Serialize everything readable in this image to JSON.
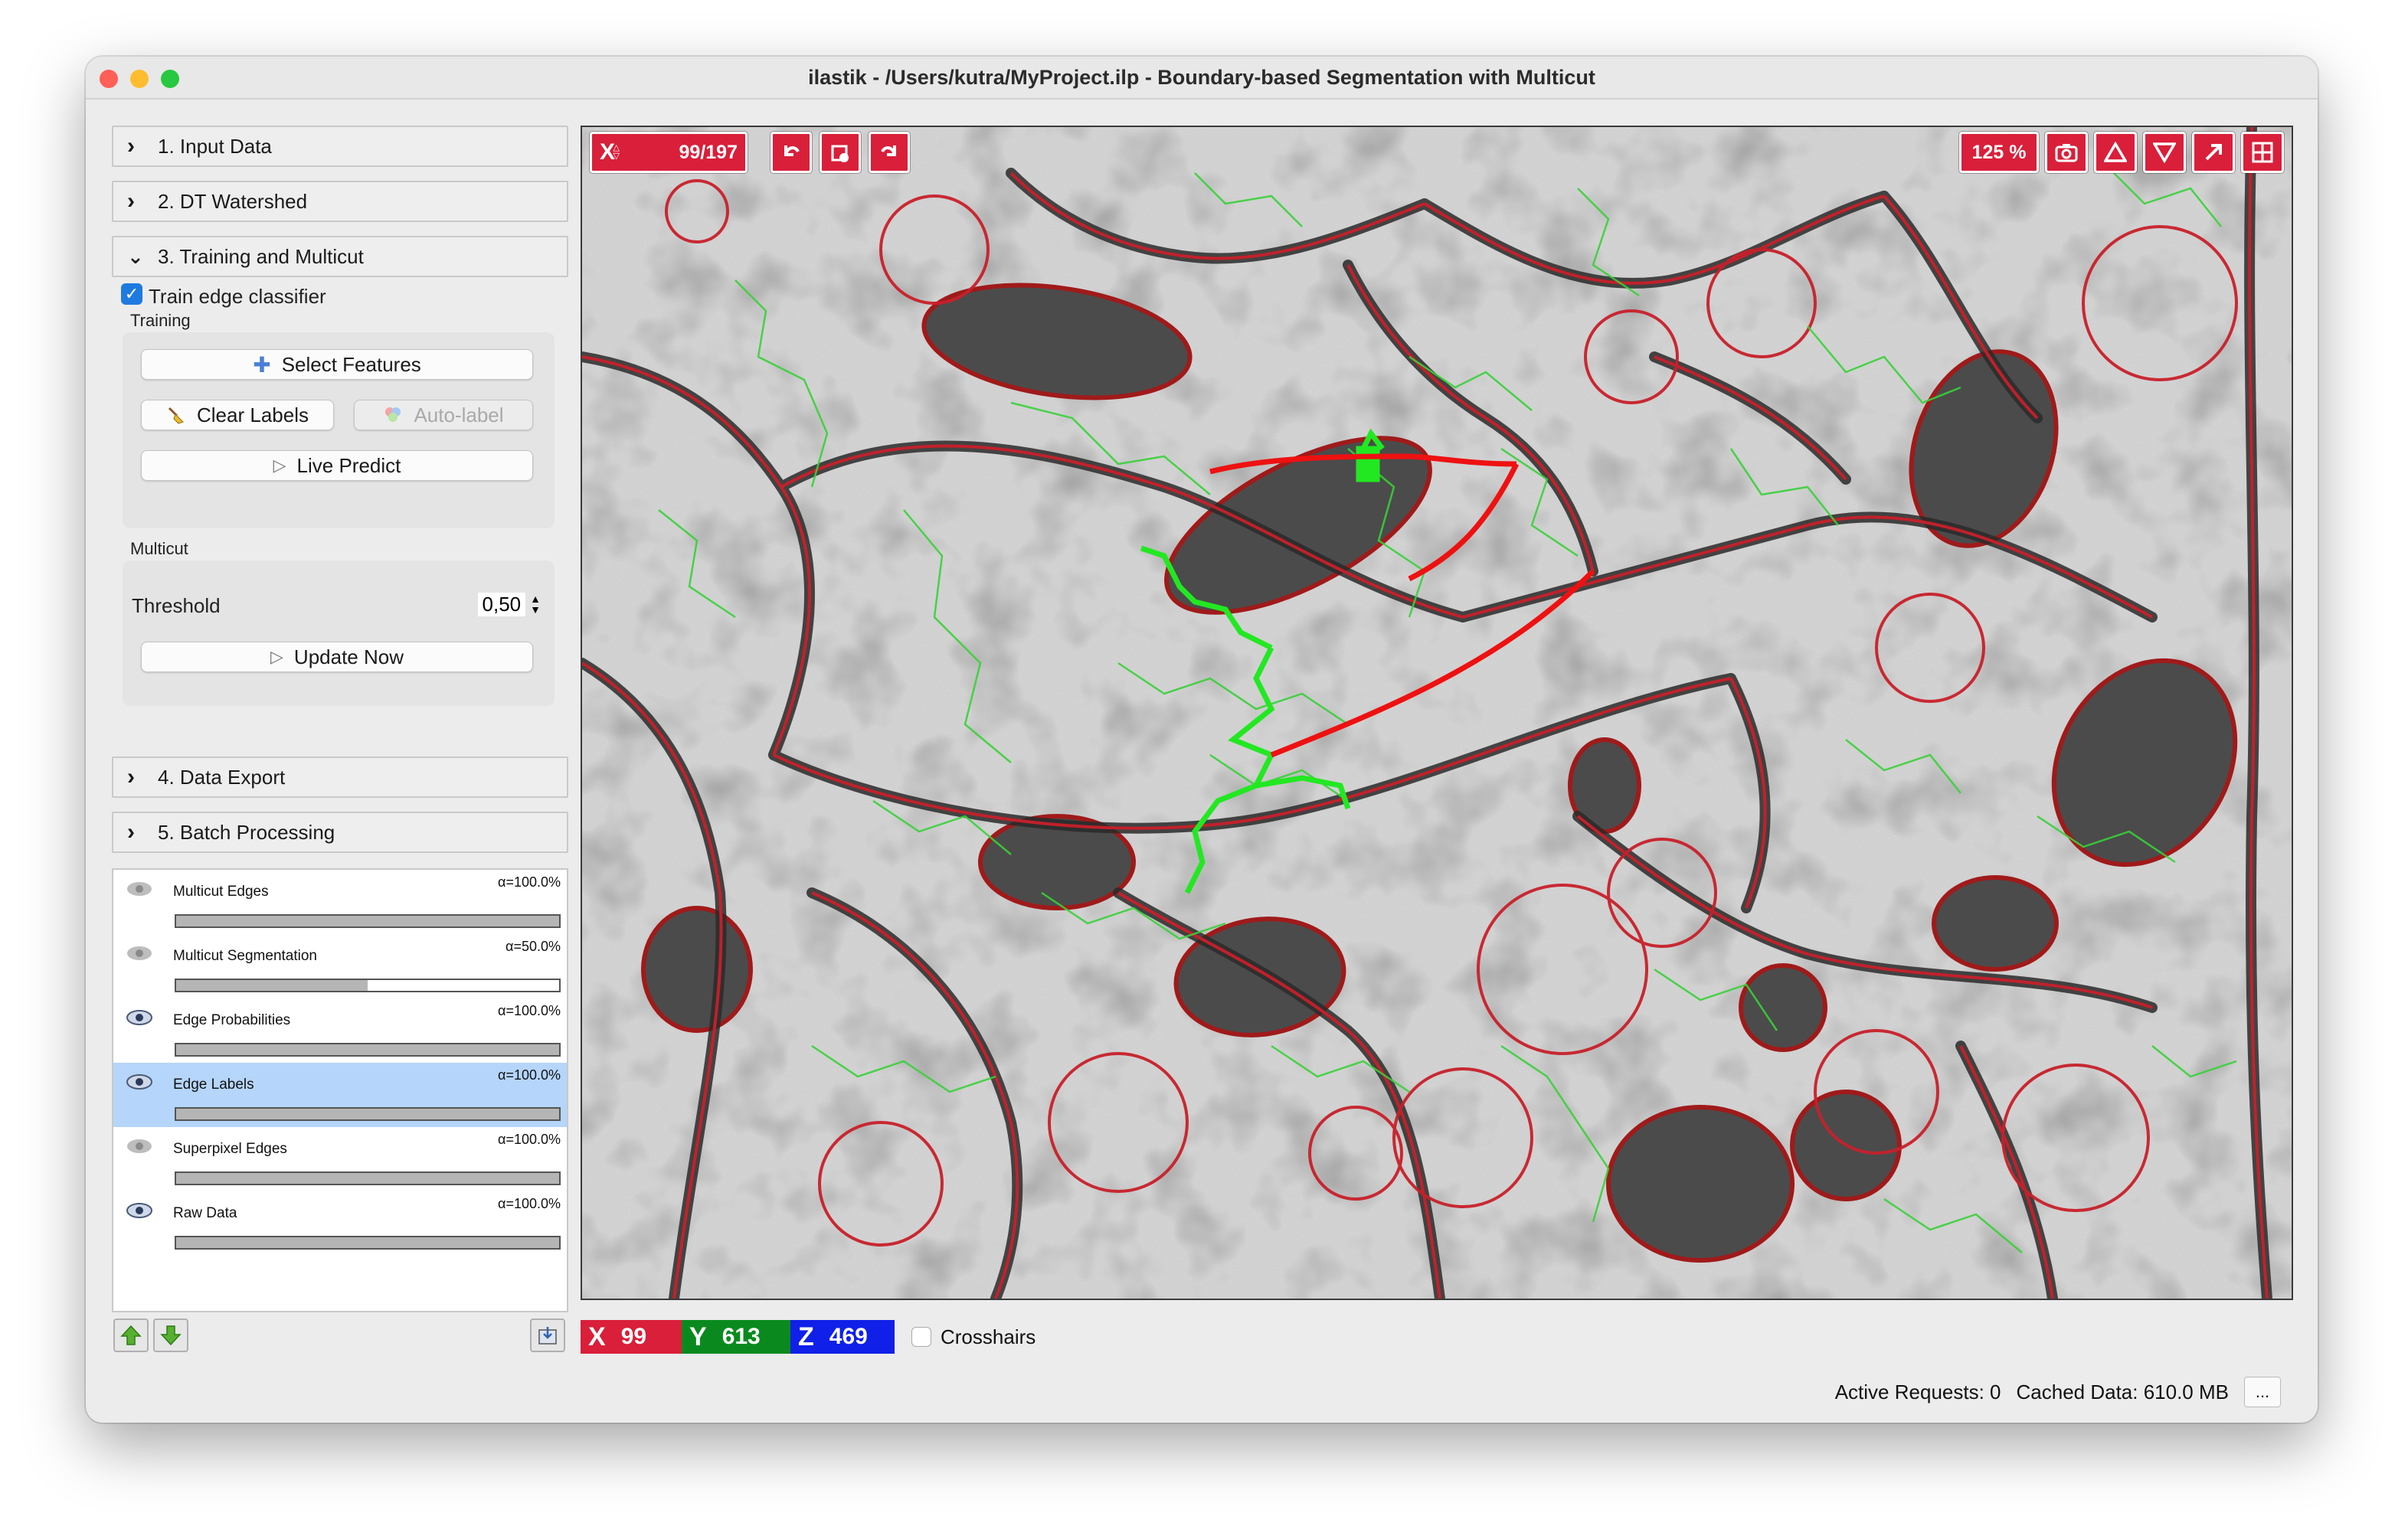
{
  "window": {
    "title": "ilastik - /Users/kutra/MyProject.ilp - Boundary-based Segmentation with Multicut",
    "traffic_colors": [
      "#fe5f57",
      "#febc2e",
      "#28c840"
    ]
  },
  "applets": [
    {
      "label": "1. Input Data",
      "expanded": false
    },
    {
      "label": "2. DT Watershed",
      "expanded": false
    },
    {
      "label": "3. Training and Multicut",
      "expanded": true
    },
    {
      "label": "4. Data Export",
      "expanded": false
    },
    {
      "label": "5. Batch Processing",
      "expanded": false
    }
  ],
  "training": {
    "train_checkbox_label": "Train edge classifier",
    "train_checked": true,
    "group_title": "Training",
    "select_features": "Select Features",
    "clear_labels": "Clear Labels",
    "auto_label": "Auto-label",
    "live_predict": "Live Predict"
  },
  "multicut": {
    "group_title": "Multicut",
    "threshold_label": "Threshold",
    "threshold_value": "0,50",
    "update_now": "Update Now"
  },
  "layers": [
    {
      "name": "Multicut Edges",
      "alpha": "α=100.0%",
      "opacity": 1.0,
      "visible": false,
      "selected": false
    },
    {
      "name": "Multicut Segmentation",
      "alpha": "α=50.0%",
      "opacity": 0.5,
      "visible": false,
      "selected": false
    },
    {
      "name": "Edge Probabilities",
      "alpha": "α=100.0%",
      "opacity": 1.0,
      "visible": true,
      "selected": false
    },
    {
      "name": "Edge Labels",
      "alpha": "α=100.0%",
      "opacity": 1.0,
      "visible": true,
      "selected": true
    },
    {
      "name": "Superpixel Edges",
      "alpha": "α=100.0%",
      "opacity": 1.0,
      "visible": false,
      "selected": false
    },
    {
      "name": "Raw Data",
      "alpha": "α=100.0%",
      "opacity": 1.0,
      "visible": true,
      "selected": false
    }
  ],
  "viewer": {
    "axis_label": "X",
    "slice": "99/197",
    "zoom": "125 %",
    "accent": "#d91f3a"
  },
  "coords": {
    "x_label": "X",
    "x_value": "99",
    "x_color": "#d91f3a",
    "y_label": "Y",
    "y_value": "613",
    "y_color": "#0a8a1e",
    "z_label": "Z",
    "z_value": "469",
    "z_color": "#1020e8",
    "crosshairs_label": "Crosshairs",
    "crosshairs_checked": false
  },
  "status": {
    "active_requests": "Active Requests: 0",
    "cached_data": "Cached Data: 610.0 MB",
    "more": "..."
  }
}
